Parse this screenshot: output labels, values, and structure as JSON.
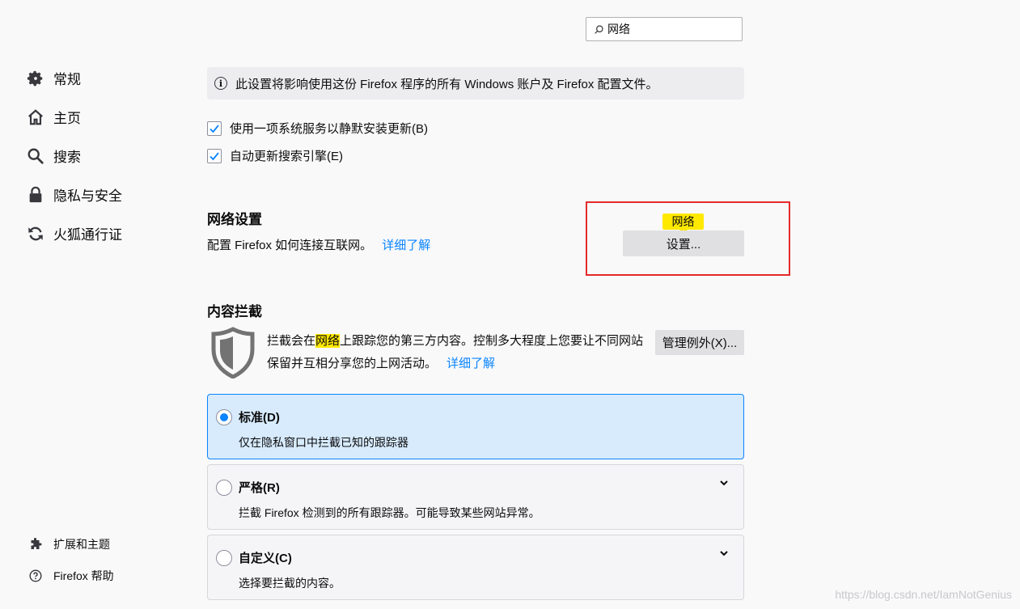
{
  "sidebar": {
    "items": [
      {
        "label": "常规",
        "icon": "gear-icon"
      },
      {
        "label": "主页",
        "icon": "home-icon"
      },
      {
        "label": "搜索",
        "icon": "search-icon"
      },
      {
        "label": "隐私与安全",
        "icon": "lock-icon"
      },
      {
        "label": "火狐通行证",
        "icon": "sync-icon"
      }
    ],
    "footer": [
      {
        "label": "扩展和主题",
        "icon": "puzzle-icon"
      },
      {
        "label": "Firefox 帮助",
        "icon": "help-icon"
      }
    ]
  },
  "search": {
    "value": "网络"
  },
  "info": {
    "text": "此设置将影响使用这份 Firefox 程序的所有 Windows 账户及 Firefox 配置文件。"
  },
  "updates": {
    "service_label": "使用一项系统服务以静默安装更新(B)",
    "engines_label": "自动更新搜索引擎(E)"
  },
  "network": {
    "title": "网络设置",
    "desc": "配置 Firefox 如何连接互联网。",
    "learn_more": "详细了解",
    "tooltip": "网络",
    "button": "设置..."
  },
  "content_blocking": {
    "title": "内容拦截",
    "desc_before": "拦截会在",
    "desc_highlight": "网络",
    "desc_after": "上跟踪您的第三方内容。控制多大程度上您要让不同网站",
    "desc_line2": "保留并互相分享您的上网活动。",
    "learn_more": "详细了解",
    "exceptions_button": "管理例外(X)...",
    "options": [
      {
        "title": "标准(D)",
        "desc": "仅在隐私窗口中拦截已知的跟踪器",
        "selected": true
      },
      {
        "title": "严格(R)",
        "desc": "拦截 Firefox 检测到的所有跟踪器。可能导致某些网站异常。",
        "selected": false
      },
      {
        "title": "自定义(C)",
        "desc": "选择要拦截的内容。",
        "selected": false
      }
    ]
  },
  "watermark": "https://blog.csdn.net/IamNotGenius",
  "colors": {
    "accent": "#0a84ff",
    "highlight": "#ffe900",
    "annotation": "#e42a2a"
  }
}
